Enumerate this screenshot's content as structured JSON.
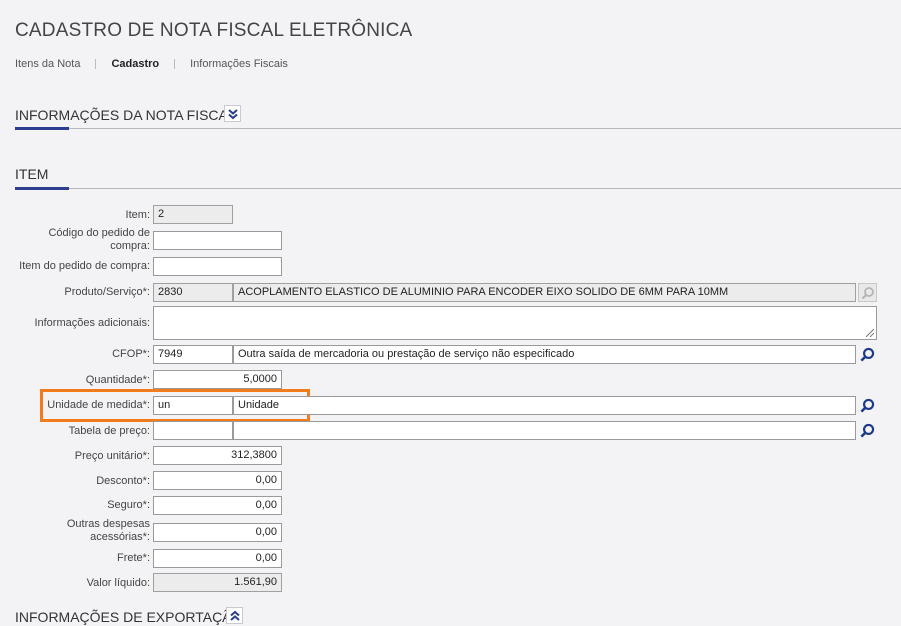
{
  "page": {
    "title": "CADASTRO DE NOTA FISCAL ELETRÔNICA"
  },
  "breadcrumb": {
    "items": [
      {
        "label": "Itens da Nota"
      },
      {
        "label": "Cadastro"
      },
      {
        "label": "Informações Fiscais"
      }
    ]
  },
  "sections": {
    "invoice_info": {
      "title": "INFORMAÇÕES DA NOTA FISCAL",
      "toggle_icon": "chevron-double-down-icon"
    },
    "item": {
      "title": "ITEM"
    },
    "export_info": {
      "title": "INFORMAÇÕES DE EXPORTAÇÃO",
      "toggle_icon": "chevron-double-up-icon"
    }
  },
  "form": {
    "item": {
      "label": "Item:",
      "value": "2"
    },
    "purchase_order_code": {
      "label_line1": "Código do pedido de",
      "label_line2": "compra:",
      "value": ""
    },
    "purchase_order_item": {
      "label": "Item do pedido de compra:",
      "value": ""
    },
    "product": {
      "label": "Produto/Serviço*:",
      "code": "2830",
      "description": "ACOPLAMENTO ELASTICO DE ALUMINIO PARA ENCODER EIXO SOLIDO DE 6MM PARA 10MM"
    },
    "additional_info": {
      "label": "Informações adicionais:",
      "value": ""
    },
    "cfop": {
      "label": "CFOP*:",
      "code": "7949",
      "description": "Outra saída de mercadoria ou prestação de serviço não especificado"
    },
    "quantity": {
      "label": "Quantidade*:",
      "value": "5,0000"
    },
    "unit": {
      "label": "Unidade de medida*:",
      "code": "un",
      "description": "Unidade"
    },
    "price_table": {
      "label": "Tabela de preço:",
      "code": "",
      "description": ""
    },
    "unit_price": {
      "label": "Preço unitário*:",
      "value": "312,3800"
    },
    "discount": {
      "label": "Desconto*:",
      "value": "0,00"
    },
    "insurance": {
      "label": "Seguro*:",
      "value": "0,00"
    },
    "other_expenses": {
      "label_line1": "Outras despesas",
      "label_line2": "acessórias*:",
      "value": "0,00"
    },
    "freight": {
      "label": "Frete*:",
      "value": "0,00"
    },
    "net_value": {
      "label": "Valor líquido:",
      "value": "1.561,90"
    }
  },
  "colors": {
    "accent": "#2c3e8f",
    "highlight": "#f27c1b",
    "background": "#f3f3f6"
  }
}
